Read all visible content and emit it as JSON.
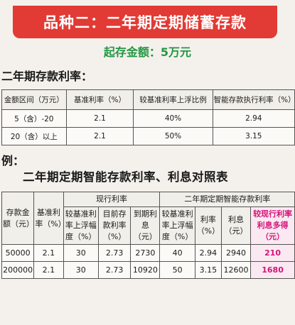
{
  "banner": {
    "title": "品种二：二年期定期储蓄存款"
  },
  "minimum_deposit": "起存金额：5万元",
  "rate_section": {
    "heading": "二年期存款利率：",
    "headers": [
      "金额区间（万元）",
      "基准利率（%）",
      "较基准利率上浮比例",
      "智能存款执行利率（%）"
    ],
    "rows": [
      [
        "5（含）-20",
        "2.1",
        "40%",
        "2.94"
      ],
      [
        "20（含）以上",
        "2.1",
        "50%",
        "3.15"
      ]
    ]
  },
  "example": {
    "label": "例：",
    "title": "二年期定期智能存款利率、利息对照表",
    "group_current": "现行利率",
    "group_smart": "二年期定期智能存款利率",
    "col_amount": "存款金额（元）",
    "col_base_rate": "基准利率（%）",
    "col_float": "较基准利率上浮幅度（%）",
    "col_current_rate": "目前存款利率（%）",
    "col_interest_due": "到期利息（元）",
    "col_smart_float": "较基准利率上浮幅度（%）",
    "col_smart_rate": "利率（%）",
    "col_smart_interest": "利息（元）",
    "col_extra": "较现行利率利息多得（元）",
    "rows": [
      [
        "50000",
        "2.1",
        "30",
        "2.73",
        "2730",
        "40",
        "2.94",
        "2940",
        "210"
      ],
      [
        "200000",
        "2.1",
        "30",
        "2.73",
        "10920",
        "50",
        "3.15",
        "12600",
        "1680"
      ]
    ]
  }
}
